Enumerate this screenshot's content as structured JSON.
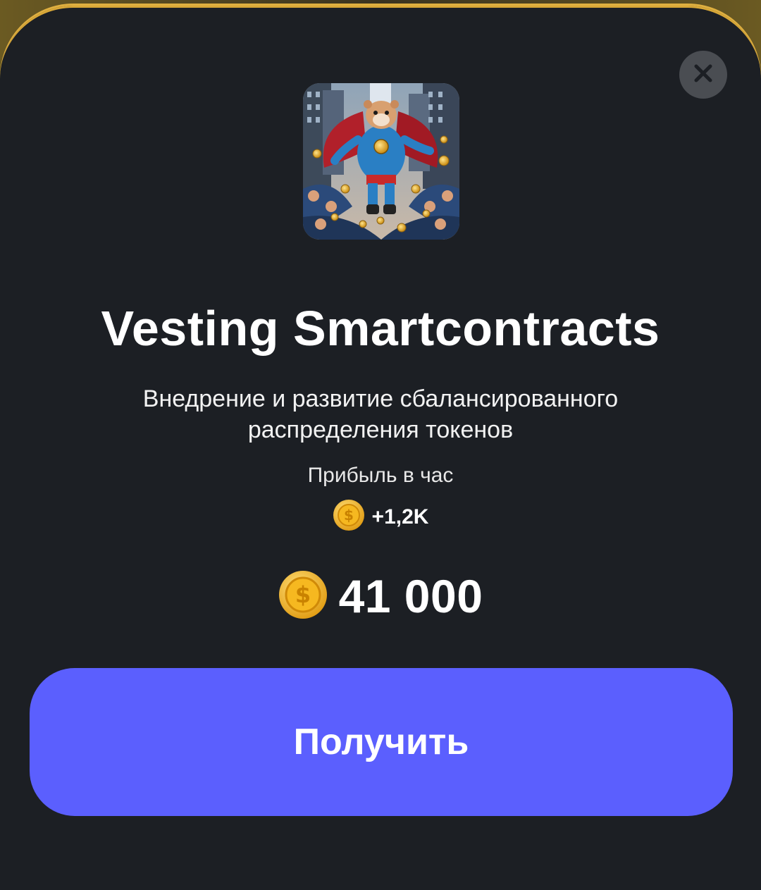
{
  "card": {
    "title": "Vesting Smartcontracts",
    "description": "Внедрение и развитие сбалансированного распределения токенов",
    "profit_label": "Прибыль в час",
    "profit_value": "+1,2K",
    "price": "41 000",
    "image_icon": "hamster-superhero-image",
    "coin_icon": "dollar-coin-icon"
  },
  "actions": {
    "get_label": "Получить",
    "close_icon": "close-icon"
  },
  "colors": {
    "background": "#1c1f24",
    "accent_border": "#e0b040",
    "button": "#5b5ffe",
    "close_bg": "#4a4d52",
    "coin": "#f2b520"
  }
}
